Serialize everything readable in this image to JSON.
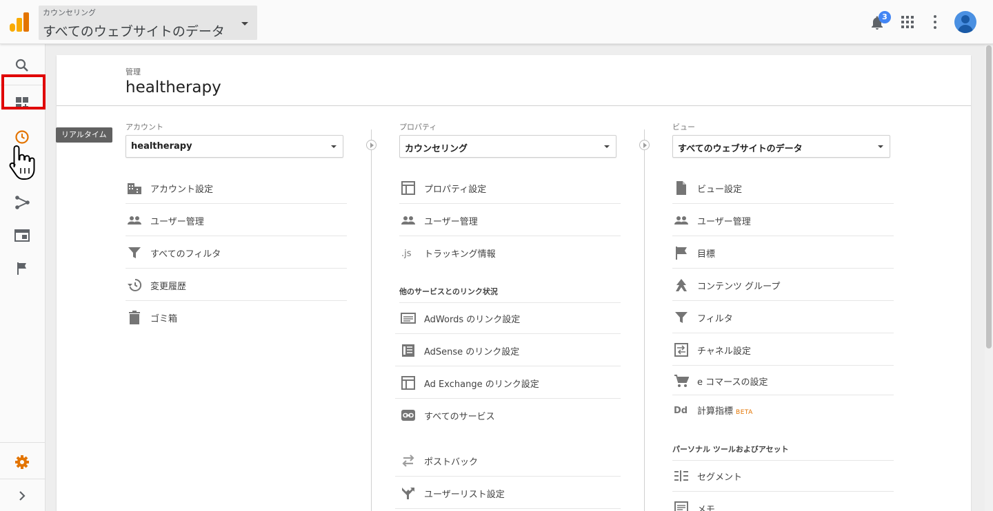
{
  "header": {
    "account_label": "カウンセリング",
    "view_name": "すべてのウェブサイトのデータ",
    "notification_count": "3"
  },
  "nav": {
    "tooltip": "リアルタイム"
  },
  "page": {
    "breadcrumb": "管理",
    "title": "healtherapy"
  },
  "account": {
    "header": "アカウント",
    "selected": "healtherapy",
    "items": [
      {
        "label": "アカウント設定",
        "icon": "building-icon"
      },
      {
        "label": "ユーザー管理",
        "icon": "people-icon"
      },
      {
        "label": "すべてのフィルタ",
        "icon": "filter-icon"
      },
      {
        "label": "変更履歴",
        "icon": "history-icon"
      },
      {
        "label": "ゴミ箱",
        "icon": "trash-icon"
      }
    ]
  },
  "property": {
    "header": "プロパティ",
    "selected": "カウンセリング",
    "items": [
      {
        "label": "プロパティ設定",
        "icon": "property-icon"
      },
      {
        "label": "ユーザー管理",
        "icon": "people-icon"
      },
      {
        "label": "トラッキング情報",
        "icon": "js-icon"
      }
    ],
    "links_section": "他のサービスとのリンク状況",
    "link_items": [
      {
        "label": "AdWords のリンク設定",
        "icon": "adwords-icon"
      },
      {
        "label": "AdSense のリンク設定",
        "icon": "adsense-icon"
      },
      {
        "label": "Ad Exchange のリンク設定",
        "icon": "adexchange-icon"
      },
      {
        "label": "すべてのサービス",
        "icon": "link-icon"
      }
    ],
    "extra_items": [
      {
        "label": "ポストバック",
        "icon": "postback-icon"
      },
      {
        "label": "ユーザーリスト設定",
        "icon": "userlist-icon"
      }
    ]
  },
  "view": {
    "header": "ビュー",
    "selected": "すべてのウェブサイトのデータ",
    "items": [
      {
        "label": "ビュー設定",
        "icon": "document-icon"
      },
      {
        "label": "ユーザー管理",
        "icon": "people-icon"
      },
      {
        "label": "目標",
        "icon": "flag-icon"
      },
      {
        "label": "コンテンツ グループ",
        "icon": "content-group-icon"
      },
      {
        "label": "フィルタ",
        "icon": "filter-icon"
      },
      {
        "label": "チャネル設定",
        "icon": "channel-icon"
      },
      {
        "label": "e コマースの設定",
        "icon": "cart-icon"
      },
      {
        "label": "計算指標",
        "icon": "calculated-metrics-icon",
        "badge": "BETA"
      }
    ],
    "personal_section": "パーソナル ツールおよびアセット",
    "personal_items": [
      {
        "label": "セグメント",
        "icon": "segment-icon"
      },
      {
        "label": "メモ",
        "icon": "memo-icon"
      }
    ]
  },
  "colors": {
    "accent_orange": "#e37400",
    "highlight_red": "#e00000",
    "badge_blue": "#4285f4"
  }
}
